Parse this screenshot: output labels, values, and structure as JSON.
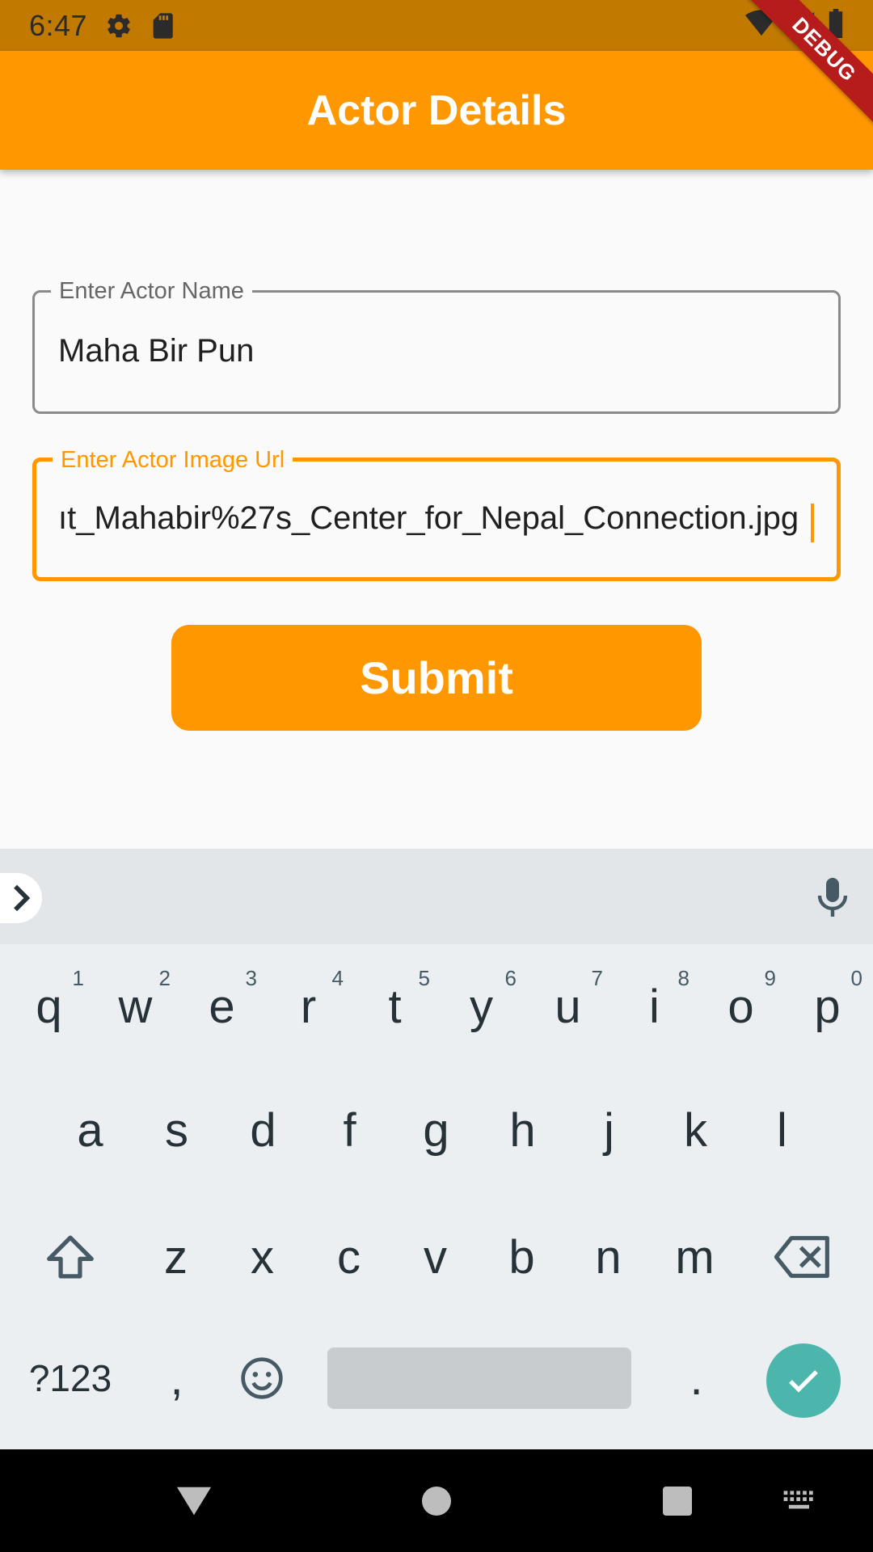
{
  "status_bar": {
    "time": "6:47",
    "icons": [
      "gear-icon",
      "sd-card-icon",
      "wifi-icon",
      "signal-icon",
      "battery-icon"
    ]
  },
  "app_bar": {
    "title": "Actor Details",
    "background": "#FF9800"
  },
  "debug_banner": "DEBUG",
  "form": {
    "name_field": {
      "label": "Enter Actor Name",
      "value": "Maha Bir Pun"
    },
    "url_field": {
      "label": "Enter Actor Image Url",
      "value": "ıt_Mahabir%27s_Center_for_Nepal_Connection.jpg",
      "focused": true
    },
    "submit_label": "Submit"
  },
  "keyboard": {
    "row1": [
      {
        "k": "q",
        "h": "1"
      },
      {
        "k": "w",
        "h": "2"
      },
      {
        "k": "e",
        "h": "3"
      },
      {
        "k": "r",
        "h": "4"
      },
      {
        "k": "t",
        "h": "5"
      },
      {
        "k": "y",
        "h": "6"
      },
      {
        "k": "u",
        "h": "7"
      },
      {
        "k": "i",
        "h": "8"
      },
      {
        "k": "o",
        "h": "9"
      },
      {
        "k": "p",
        "h": "0"
      }
    ],
    "row2": [
      "a",
      "s",
      "d",
      "f",
      "g",
      "h",
      "j",
      "k",
      "l"
    ],
    "row3": [
      "z",
      "x",
      "c",
      "v",
      "b",
      "n",
      "m"
    ],
    "symbols_label": "?123",
    "comma": ",",
    "period": ".",
    "accent": "#4DB6AC"
  },
  "nav_bar": {
    "buttons": [
      "back-triangle-icon",
      "home-circle-icon",
      "recents-square-icon",
      "keyboard-switch-icon"
    ]
  }
}
